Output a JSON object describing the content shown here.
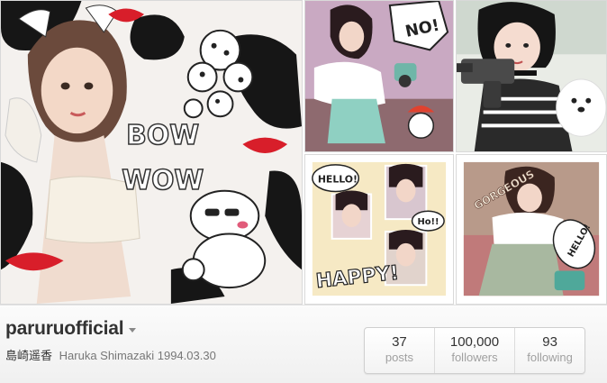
{
  "profile": {
    "username": "paruruofficial",
    "bio_japanese": "島崎遥香",
    "bio_english": "Haruka Shimazaki 1994.03.30"
  },
  "stats": [
    {
      "value": "37",
      "label": "posts"
    },
    {
      "value": "100,000",
      "label": "followers"
    },
    {
      "value": "93",
      "label": "following"
    }
  ],
  "collage": {
    "big_tile": {
      "text_1": "BOW",
      "text_2": "WOW"
    },
    "tile_top_mid": {
      "sticker": "NO!"
    },
    "tile_bottom_mid": {
      "bubble_1": "HELLO!",
      "bubble_2": "Ho!!",
      "caption": "HAPPY!"
    },
    "tile_bottom_right": {
      "caption": "GORGEOUS",
      "bubble": "HELLO!"
    }
  },
  "colors": {
    "lipstick": "#d81e2a",
    "dark_text": "#333333",
    "muted_text": "#a0a0a0"
  }
}
